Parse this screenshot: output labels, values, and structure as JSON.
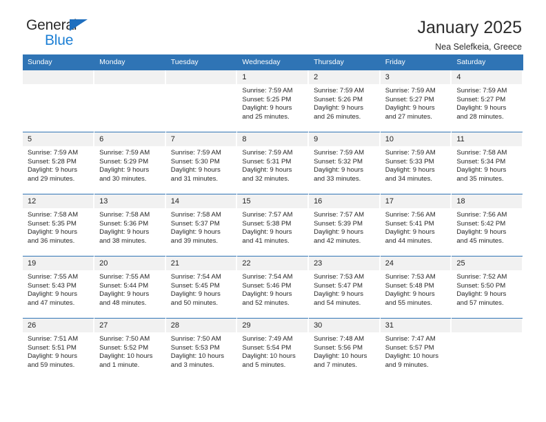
{
  "brand": {
    "line1": "General",
    "line2": "Blue",
    "triangle_icon": "triangle-icon",
    "color_dark": "#2b2b2b",
    "color_blue": "#1c7fd4"
  },
  "header": {
    "title": "January 2025",
    "subtitle": "Nea Selefkeia, Greece"
  },
  "colors": {
    "header_blue": "#2f74b5",
    "daynum_bg": "#f1f1f1",
    "text": "#262626"
  },
  "weekdays": [
    "Sunday",
    "Monday",
    "Tuesday",
    "Wednesday",
    "Thursday",
    "Friday",
    "Saturday"
  ],
  "weeks": [
    [
      {
        "day": "",
        "sunrise": "",
        "sunset": "",
        "daylight1": "",
        "daylight2": ""
      },
      {
        "day": "",
        "sunrise": "",
        "sunset": "",
        "daylight1": "",
        "daylight2": ""
      },
      {
        "day": "",
        "sunrise": "",
        "sunset": "",
        "daylight1": "",
        "daylight2": ""
      },
      {
        "day": "1",
        "sunrise": "Sunrise: 7:59 AM",
        "sunset": "Sunset: 5:25 PM",
        "daylight1": "Daylight: 9 hours",
        "daylight2": "and 25 minutes."
      },
      {
        "day": "2",
        "sunrise": "Sunrise: 7:59 AM",
        "sunset": "Sunset: 5:26 PM",
        "daylight1": "Daylight: 9 hours",
        "daylight2": "and 26 minutes."
      },
      {
        "day": "3",
        "sunrise": "Sunrise: 7:59 AM",
        "sunset": "Sunset: 5:27 PM",
        "daylight1": "Daylight: 9 hours",
        "daylight2": "and 27 minutes."
      },
      {
        "day": "4",
        "sunrise": "Sunrise: 7:59 AM",
        "sunset": "Sunset: 5:27 PM",
        "daylight1": "Daylight: 9 hours",
        "daylight2": "and 28 minutes."
      }
    ],
    [
      {
        "day": "5",
        "sunrise": "Sunrise: 7:59 AM",
        "sunset": "Sunset: 5:28 PM",
        "daylight1": "Daylight: 9 hours",
        "daylight2": "and 29 minutes."
      },
      {
        "day": "6",
        "sunrise": "Sunrise: 7:59 AM",
        "sunset": "Sunset: 5:29 PM",
        "daylight1": "Daylight: 9 hours",
        "daylight2": "and 30 minutes."
      },
      {
        "day": "7",
        "sunrise": "Sunrise: 7:59 AM",
        "sunset": "Sunset: 5:30 PM",
        "daylight1": "Daylight: 9 hours",
        "daylight2": "and 31 minutes."
      },
      {
        "day": "8",
        "sunrise": "Sunrise: 7:59 AM",
        "sunset": "Sunset: 5:31 PM",
        "daylight1": "Daylight: 9 hours",
        "daylight2": "and 32 minutes."
      },
      {
        "day": "9",
        "sunrise": "Sunrise: 7:59 AM",
        "sunset": "Sunset: 5:32 PM",
        "daylight1": "Daylight: 9 hours",
        "daylight2": "and 33 minutes."
      },
      {
        "day": "10",
        "sunrise": "Sunrise: 7:59 AM",
        "sunset": "Sunset: 5:33 PM",
        "daylight1": "Daylight: 9 hours",
        "daylight2": "and 34 minutes."
      },
      {
        "day": "11",
        "sunrise": "Sunrise: 7:58 AM",
        "sunset": "Sunset: 5:34 PM",
        "daylight1": "Daylight: 9 hours",
        "daylight2": "and 35 minutes."
      }
    ],
    [
      {
        "day": "12",
        "sunrise": "Sunrise: 7:58 AM",
        "sunset": "Sunset: 5:35 PM",
        "daylight1": "Daylight: 9 hours",
        "daylight2": "and 36 minutes."
      },
      {
        "day": "13",
        "sunrise": "Sunrise: 7:58 AM",
        "sunset": "Sunset: 5:36 PM",
        "daylight1": "Daylight: 9 hours",
        "daylight2": "and 38 minutes."
      },
      {
        "day": "14",
        "sunrise": "Sunrise: 7:58 AM",
        "sunset": "Sunset: 5:37 PM",
        "daylight1": "Daylight: 9 hours",
        "daylight2": "and 39 minutes."
      },
      {
        "day": "15",
        "sunrise": "Sunrise: 7:57 AM",
        "sunset": "Sunset: 5:38 PM",
        "daylight1": "Daylight: 9 hours",
        "daylight2": "and 41 minutes."
      },
      {
        "day": "16",
        "sunrise": "Sunrise: 7:57 AM",
        "sunset": "Sunset: 5:39 PM",
        "daylight1": "Daylight: 9 hours",
        "daylight2": "and 42 minutes."
      },
      {
        "day": "17",
        "sunrise": "Sunrise: 7:56 AM",
        "sunset": "Sunset: 5:41 PM",
        "daylight1": "Daylight: 9 hours",
        "daylight2": "and 44 minutes."
      },
      {
        "day": "18",
        "sunrise": "Sunrise: 7:56 AM",
        "sunset": "Sunset: 5:42 PM",
        "daylight1": "Daylight: 9 hours",
        "daylight2": "and 45 minutes."
      }
    ],
    [
      {
        "day": "19",
        "sunrise": "Sunrise: 7:55 AM",
        "sunset": "Sunset: 5:43 PM",
        "daylight1": "Daylight: 9 hours",
        "daylight2": "and 47 minutes."
      },
      {
        "day": "20",
        "sunrise": "Sunrise: 7:55 AM",
        "sunset": "Sunset: 5:44 PM",
        "daylight1": "Daylight: 9 hours",
        "daylight2": "and 48 minutes."
      },
      {
        "day": "21",
        "sunrise": "Sunrise: 7:54 AM",
        "sunset": "Sunset: 5:45 PM",
        "daylight1": "Daylight: 9 hours",
        "daylight2": "and 50 minutes."
      },
      {
        "day": "22",
        "sunrise": "Sunrise: 7:54 AM",
        "sunset": "Sunset: 5:46 PM",
        "daylight1": "Daylight: 9 hours",
        "daylight2": "and 52 minutes."
      },
      {
        "day": "23",
        "sunrise": "Sunrise: 7:53 AM",
        "sunset": "Sunset: 5:47 PM",
        "daylight1": "Daylight: 9 hours",
        "daylight2": "and 54 minutes."
      },
      {
        "day": "24",
        "sunrise": "Sunrise: 7:53 AM",
        "sunset": "Sunset: 5:48 PM",
        "daylight1": "Daylight: 9 hours",
        "daylight2": "and 55 minutes."
      },
      {
        "day": "25",
        "sunrise": "Sunrise: 7:52 AM",
        "sunset": "Sunset: 5:50 PM",
        "daylight1": "Daylight: 9 hours",
        "daylight2": "and 57 minutes."
      }
    ],
    [
      {
        "day": "26",
        "sunrise": "Sunrise: 7:51 AM",
        "sunset": "Sunset: 5:51 PM",
        "daylight1": "Daylight: 9 hours",
        "daylight2": "and 59 minutes."
      },
      {
        "day": "27",
        "sunrise": "Sunrise: 7:50 AM",
        "sunset": "Sunset: 5:52 PM",
        "daylight1": "Daylight: 10 hours",
        "daylight2": "and 1 minute."
      },
      {
        "day": "28",
        "sunrise": "Sunrise: 7:50 AM",
        "sunset": "Sunset: 5:53 PM",
        "daylight1": "Daylight: 10 hours",
        "daylight2": "and 3 minutes."
      },
      {
        "day": "29",
        "sunrise": "Sunrise: 7:49 AM",
        "sunset": "Sunset: 5:54 PM",
        "daylight1": "Daylight: 10 hours",
        "daylight2": "and 5 minutes."
      },
      {
        "day": "30",
        "sunrise": "Sunrise: 7:48 AM",
        "sunset": "Sunset: 5:56 PM",
        "daylight1": "Daylight: 10 hours",
        "daylight2": "and 7 minutes."
      },
      {
        "day": "31",
        "sunrise": "Sunrise: 7:47 AM",
        "sunset": "Sunset: 5:57 PM",
        "daylight1": "Daylight: 10 hours",
        "daylight2": "and 9 minutes."
      },
      {
        "day": "",
        "sunrise": "",
        "sunset": "",
        "daylight1": "",
        "daylight2": ""
      }
    ]
  ]
}
